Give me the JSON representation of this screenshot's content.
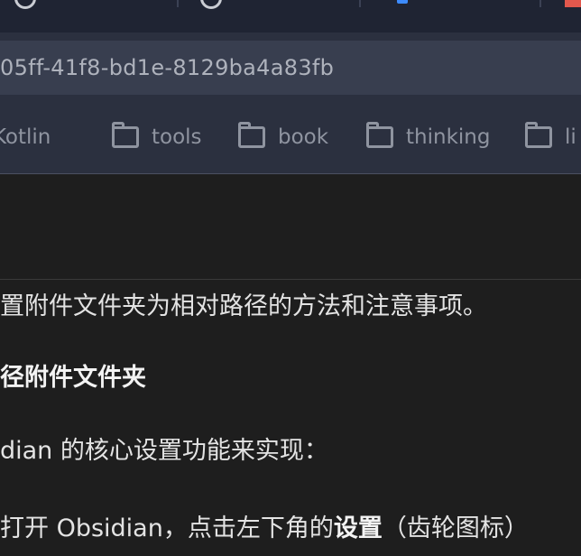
{
  "browser": {
    "address_text": "05ff-41f8-bd1e-8129ba4a83fb",
    "bookmarks": [
      {
        "label": "Kotlin"
      },
      {
        "label": "tools"
      },
      {
        "label": "book"
      },
      {
        "label": "thinking"
      },
      {
        "label": "li"
      }
    ],
    "accent_color": "#e2584d"
  },
  "document": {
    "line1": "置附件文件夹为相对路径的方法和注意事项。",
    "heading": "径附件文件夹",
    "line2": "dian 的核心设置功能来实现：",
    "line3_before": "打开 Obsidian，点击左下角的",
    "line3_bold": "设置",
    "line3_after": "（齿轮图标）"
  }
}
